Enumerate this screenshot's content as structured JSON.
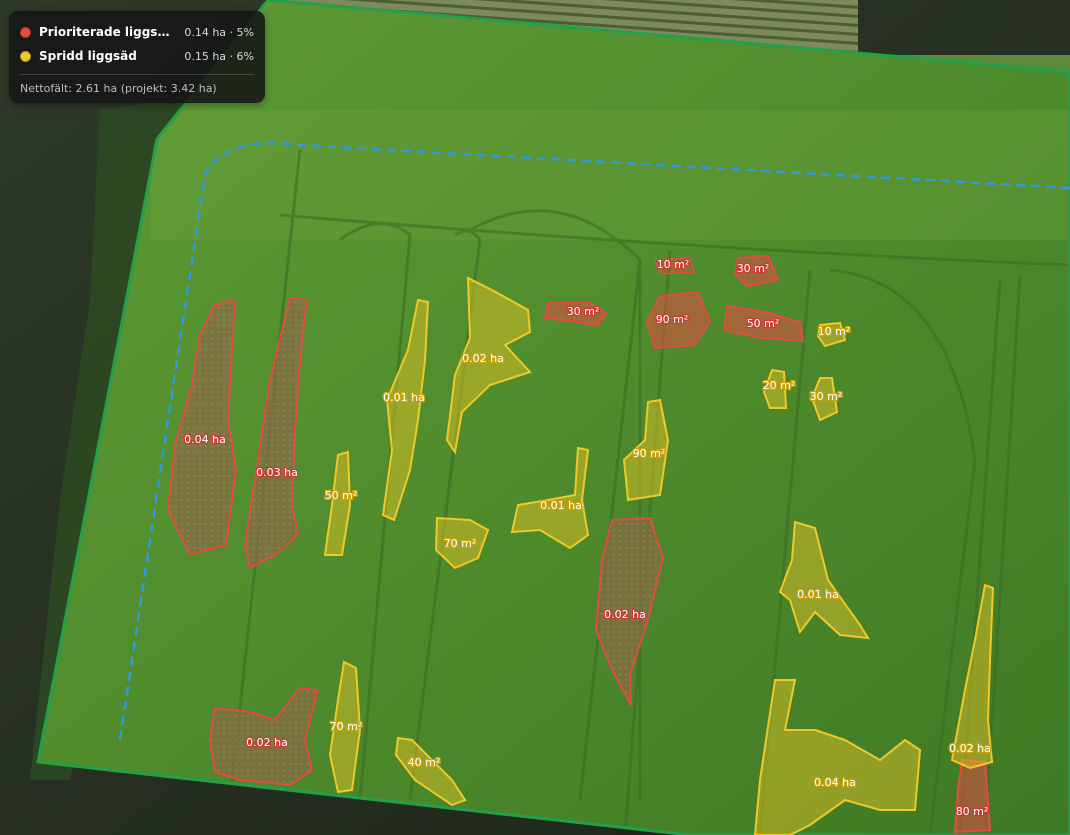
{
  "legend": {
    "items": [
      {
        "label": "Prioriterade liggsädso...",
        "value": "0.14 ha · 5%",
        "color": "#e34b43"
      },
      {
        "label": "Spridd liggsäd",
        "value": "0.15 ha · 6%",
        "color": "#f1c826"
      }
    ],
    "footer": "Nettofält: 2.61 ha (projekt: 3.42 ha)"
  },
  "zones": [
    {
      "label": "0.04 ha",
      "category": "prioriterade"
    },
    {
      "label": "0.03 ha",
      "category": "prioriterade"
    },
    {
      "label": "30 m²",
      "category": "prioriterade"
    },
    {
      "label": "10 m²",
      "category": "prioriterade"
    },
    {
      "label": "90 m²",
      "category": "prioriterade"
    },
    {
      "label": "30 m²",
      "category": "prioriterade"
    },
    {
      "label": "50 m²",
      "category": "prioriterade"
    },
    {
      "label": "0.02 ha",
      "category": "prioriterade"
    },
    {
      "label": "0.02 ha",
      "category": "prioriterade"
    },
    {
      "label": "80 m²",
      "category": "prioriterade"
    },
    {
      "label": "0.02 ha",
      "category": "spridd"
    },
    {
      "label": "0.01 ha",
      "category": "spridd"
    },
    {
      "label": "50 m²",
      "category": "spridd"
    },
    {
      "label": "70 m²",
      "category": "spridd"
    },
    {
      "label": "0.01 ha",
      "category": "spridd"
    },
    {
      "label": "90 m²",
      "category": "spridd"
    },
    {
      "label": "10 m²",
      "category": "spridd"
    },
    {
      "label": "20 m²",
      "category": "spridd"
    },
    {
      "label": "30 m²",
      "category": "spridd"
    },
    {
      "label": "0.01 ha",
      "category": "spridd"
    },
    {
      "label": "70 m²",
      "category": "spridd"
    },
    {
      "label": "40 m²",
      "category": "spridd"
    },
    {
      "label": "0.04 ha",
      "category": "spridd"
    },
    {
      "label": "0.02 ha",
      "category": "spridd"
    }
  ]
}
